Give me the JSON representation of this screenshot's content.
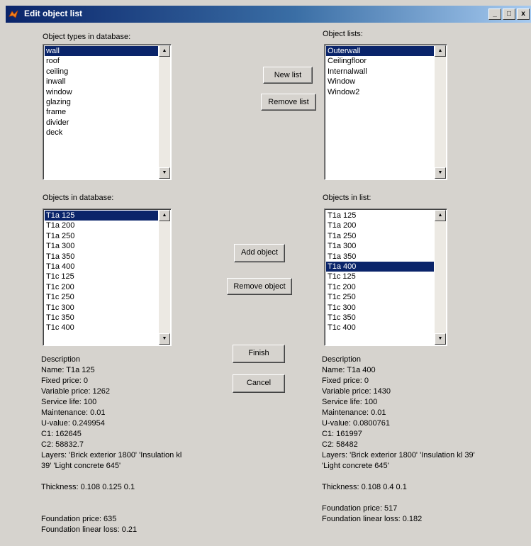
{
  "window": {
    "title": "Edit object list",
    "min": "_",
    "max": "□",
    "close": "x"
  },
  "labels": {
    "object_types": "Object types in database:",
    "object_lists": "Object lists:",
    "objects_db": "Objects in database:",
    "objects_list": "Objects in list:"
  },
  "object_types": [
    "wall",
    "roof",
    "ceiling",
    "inwall",
    "window",
    "glazing",
    "frame",
    "divider",
    "deck"
  ],
  "object_types_selected": 0,
  "object_lists": [
    "Outerwall",
    "Ceilingfloor",
    "Internalwall",
    "Window",
    "Window2"
  ],
  "object_lists_selected": 0,
  "objects_db": [
    "T1a 125",
    "T1a 200",
    "T1a 250",
    "T1a 300",
    "T1a 350",
    "T1a 400",
    "T1c 125",
    "T1c 200",
    "T1c 250",
    "T1c 300",
    "T1c 350",
    "T1c 400"
  ],
  "objects_db_selected": 0,
  "objects_list": [
    "T1a 125",
    "T1a 200",
    "T1a 250",
    "T1a 300",
    "T1a 350",
    "T1a 400",
    "T1c 125",
    "T1c 200",
    "T1c 250",
    "T1c 300",
    "T1c 350",
    "T1c 400"
  ],
  "objects_list_selected": 5,
  "buttons": {
    "new_list": "New list",
    "remove_list": "Remove list",
    "add_object": "Add object",
    "remove_object": "Remove object",
    "finish": "Finish",
    "cancel": "Cancel"
  },
  "desc_left": {
    "heading": "Description",
    "name": "Name: T1a 125",
    "fixed_price": "Fixed price: 0",
    "variable_price": "Variable price: 1262",
    "service_life": "Service life: 100",
    "maintenance": "Maintenance: 0.01",
    "u_value": "U-value: 0.249954",
    "c1": "C1: 162645",
    "c2": "C2: 58832.7",
    "layers1": "Layers:  'Brick exterior 1800'  'Insulation kl",
    "layers2": "39'  'Light concrete 645'",
    "thickness": "Thickness:    0.108   0.125   0.1",
    "foundation_price": "Foundation price: 635",
    "foundation_loss": "Foundation linear loss: 0.21"
  },
  "desc_right": {
    "heading": "Description",
    "name": "Name: T1a 400",
    "fixed_price": "Fixed price: 0",
    "variable_price": "Variable price: 1430",
    "service_life": "Service life: 100",
    "maintenance": "Maintenance: 0.01",
    "u_value": "U-value: 0.0800761",
    "c1": "C1: 161997",
    "c2": "C2: 58482",
    "layers1": "Layers:  'Brick exterior 1800'  'Insulation kl 39'",
    "layers2": "'Light concrete 645'",
    "thickness": "Thickness:    0.108   0.4   0.1",
    "foundation_price": "Foundation price: 517",
    "foundation_loss": "Foundation linear loss: 0.182"
  }
}
